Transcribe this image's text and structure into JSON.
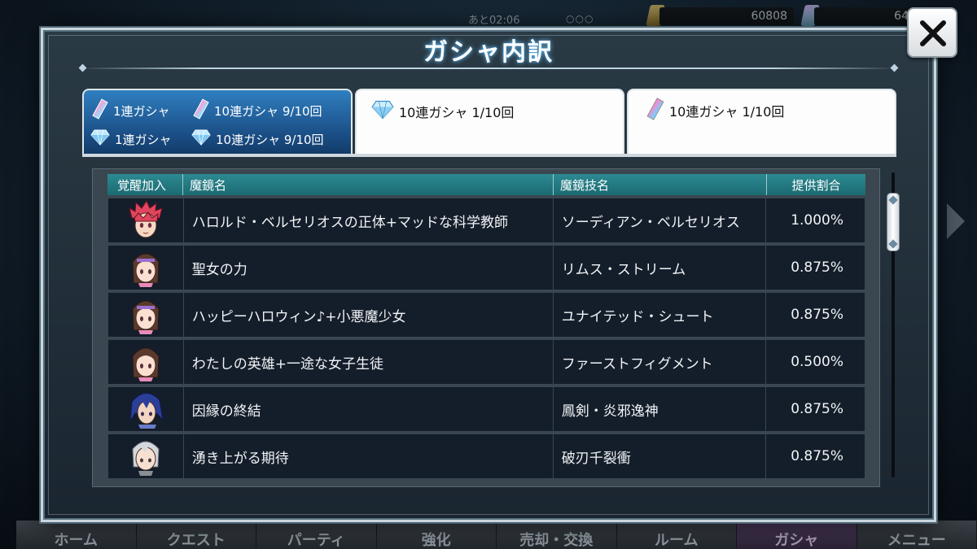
{
  "hud": {
    "timer": "あと02:06",
    "circles": "○○○",
    "currency_gold": "60808",
    "currency_crystal": "64"
  },
  "nav": [
    "ホーム",
    "クエスト",
    "パーティ",
    "強化",
    "売却・交換",
    "ルーム",
    "ガシャ",
    "メニュー"
  ],
  "modal": {
    "title": "ガシャ内訳",
    "tabs": {
      "active": {
        "row1_left": "1連ガシャ",
        "row1_right": "10連ガシャ 9/10回",
        "row2_left": "1連ガシャ",
        "row2_right": "10連ガシャ 9/10回"
      },
      "tab2": "10連ガシャ 1/10回",
      "tab3": "10連ガシャ 1/10回"
    },
    "table": {
      "headers": [
        "覚醒加入",
        "魔鏡名",
        "魔鏡技名",
        "提供割合"
      ],
      "rows": [
        {
          "avatar": "red-haired-boy-icon",
          "name": "ハロルド・ベルセリオスの正体+マッドな科学教師",
          "skill": "ソーディアン・ベルセリオス",
          "rate": "1.000%"
        },
        {
          "avatar": "brown-haired-girl-icon",
          "name": "聖女の力",
          "skill": "リムス・ストリーム",
          "rate": "0.875%"
        },
        {
          "avatar": "brown-haired-girl-icon",
          "name": "ハッピーハロウィン♪+小悪魔少女",
          "skill": "ユナイテッド・シュート",
          "rate": "0.875%"
        },
        {
          "avatar": "brown-haired-girl-icon",
          "name": "わたしの英雄+一途な女子生徒",
          "skill": "ファーストフィグメント",
          "rate": "0.500%"
        },
        {
          "avatar": "blue-haired-man-icon",
          "name": "因縁の終結",
          "skill": "鳳剣・炎邪逸神",
          "rate": "0.875%"
        },
        {
          "avatar": "silver-haired-man-icon",
          "name": "湧き上がる期待",
          "skill": "破刃千裂衝",
          "rate": "0.875%"
        }
      ]
    }
  },
  "colors": {
    "tab_active": "#1a4d84",
    "header": "#1c6a72",
    "row_bg": "#141e2b",
    "title_glow": "#6ec6ff"
  }
}
